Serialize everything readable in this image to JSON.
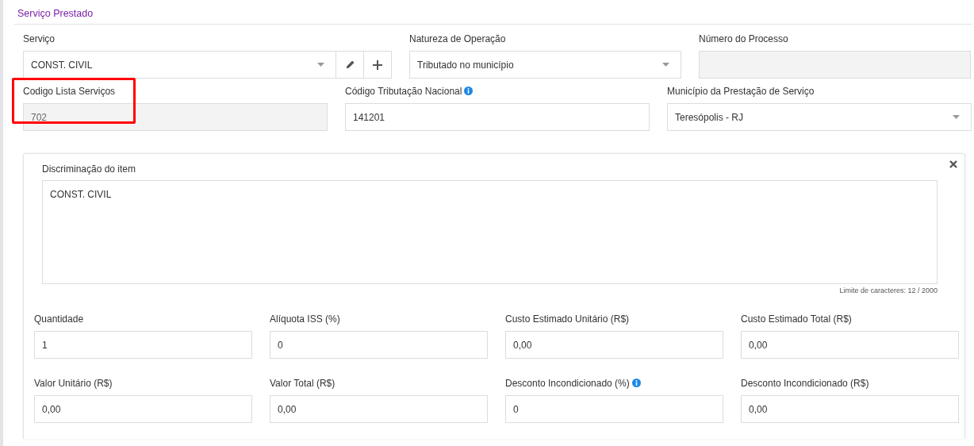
{
  "section": {
    "title": "Serviço Prestado"
  },
  "top_rows": [
    [
      {
        "label": "Serviço",
        "kind": "select",
        "value": "CONST. CIVIL",
        "disabled": false,
        "info": false,
        "highlighted": false,
        "actions": true
      },
      {
        "label": "Natureza de Operação",
        "kind": "select",
        "value": "Tributado no município",
        "disabled": false,
        "info": false,
        "highlighted": false,
        "actions": false
      },
      {
        "label": "Número do Processo",
        "kind": "text",
        "disabled": true,
        "info": false,
        "highlighted": false,
        "actions": false
      }
    ],
    [
      {
        "label": "Codigo Lista Serviços",
        "kind": "text",
        "value": "702",
        "disabled": true,
        "info": false,
        "highlighted": true,
        "actions": false
      },
      {
        "label": "Código Tributação Nacional",
        "kind": "text",
        "value": "141201",
        "disabled": false,
        "info": true,
        "highlighted": false,
        "actions": false
      },
      {
        "label": "Município da Prestação de Serviço",
        "kind": "select",
        "value": "Teresópolis - RJ",
        "disabled": false,
        "info": false,
        "highlighted": false,
        "actions": false
      }
    ]
  ],
  "item": {
    "description_label": "Discriminação do item",
    "description": "CONST. CIVIL",
    "counter": "Limite de caracteres: 12 / 2000",
    "fields": [
      {
        "label": "Quantidade",
        "value": "1",
        "info": false
      },
      {
        "label": "Alíquota ISS (%)",
        "value": "0",
        "info": false
      },
      {
        "label": "Custo Estimado Unitário (R$)",
        "value": "0,00",
        "info": false
      },
      {
        "label": "Custo Estimado Total (R$)",
        "value": "0,00",
        "info": false
      },
      {
        "label": "Valor Unitário (R$)",
        "value": "0,00",
        "info": false
      },
      {
        "label": "Valor Total (R$)",
        "value": "0,00",
        "info": false
      },
      {
        "label": "Desconto Incondicionado (%)",
        "value": "0",
        "info": true
      },
      {
        "label": "Desconto Incondicionado (R$)",
        "value": "0,00",
        "info": false
      }
    ]
  }
}
